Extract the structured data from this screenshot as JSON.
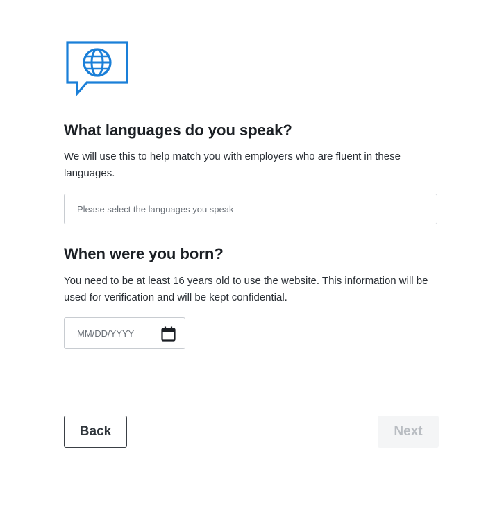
{
  "languages": {
    "title": "What languages do you speak?",
    "description": "We will use this to help match you with employers who are fluent in these languages.",
    "placeholder": "Please select the languages you speak",
    "value": ""
  },
  "birthdate": {
    "title": "When were you born?",
    "description": "You need to be at least 16 years old to use the website. This information will be used for verification and will be kept confidential.",
    "placeholder": "MM/DD/YYYY",
    "value": ""
  },
  "footer": {
    "back_label": "Back",
    "next_label": "Next"
  },
  "icons": {
    "hero": "globe-speech-bubble-icon",
    "date": "calendar-icon"
  },
  "colors": {
    "accent": "#1a7fd8",
    "text": "#1b1f24",
    "disabled_bg": "#f4f5f6",
    "disabled_text": "#b9bdc2"
  }
}
